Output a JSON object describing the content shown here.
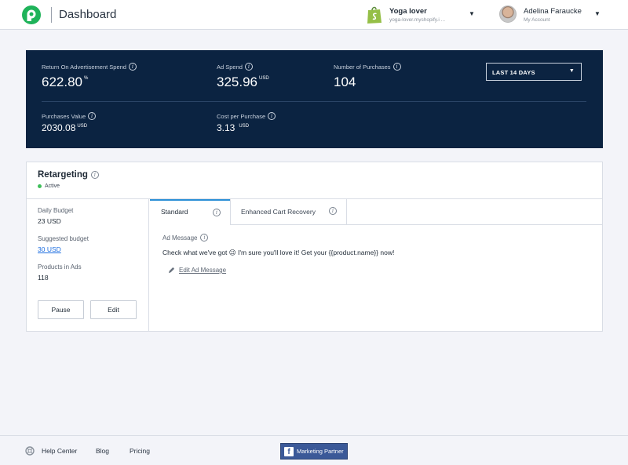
{
  "header": {
    "title": "Dashboard",
    "store": {
      "name": "Yoga lover",
      "url": "yoga-lover.myshopify.i ..."
    },
    "account": {
      "name": "Adelina Faraucke",
      "sub": "My Account"
    }
  },
  "stats": {
    "roas": {
      "label": "Return On Advertisement Spend",
      "value": "622.80",
      "unit": "%"
    },
    "ad_spend": {
      "label": "Ad Spend",
      "value": "325.96",
      "unit": "USD"
    },
    "purchases": {
      "label": "Number of Purchases",
      "value": "104"
    },
    "purchases_value": {
      "label": "Purchases Value",
      "value": "2030.08",
      "unit": "USD"
    },
    "cost_per_purchase": {
      "label": "Cost per Purchase",
      "value": "3.13",
      "unit": "USD"
    },
    "range": {
      "selected": "LAST 14 DAYS"
    }
  },
  "campaign": {
    "title": "Retargeting",
    "status": "Active",
    "status_color": "#3fbf5a",
    "daily_budget": {
      "label": "Daily Budget",
      "value": "23 USD"
    },
    "suggested_budget": {
      "label": "Suggested budget",
      "value": "30 USD"
    },
    "products": {
      "label": "Products in Ads",
      "value": "118"
    },
    "buttons": {
      "pause": "Pause",
      "edit": "Edit"
    },
    "tabs": [
      {
        "label": "Standard"
      },
      {
        "label": "Enhanced Cart Recovery"
      }
    ],
    "ad_message": {
      "label": "Ad Message",
      "text": "Check what we've got 😉 I'm sure you'll love it! Get your {{product.name}} now!",
      "edit_label": "Edit Ad Message"
    }
  },
  "footer": {
    "help": "Help Center",
    "blog": "Blog",
    "pricing": "Pricing",
    "badge": "Marketing Partner"
  },
  "colors": {
    "brand_green": "#1fb35a",
    "panel_navy": "#0b2341",
    "accent_blue": "#2b8fd6",
    "facebook_blue": "#3b5998"
  }
}
